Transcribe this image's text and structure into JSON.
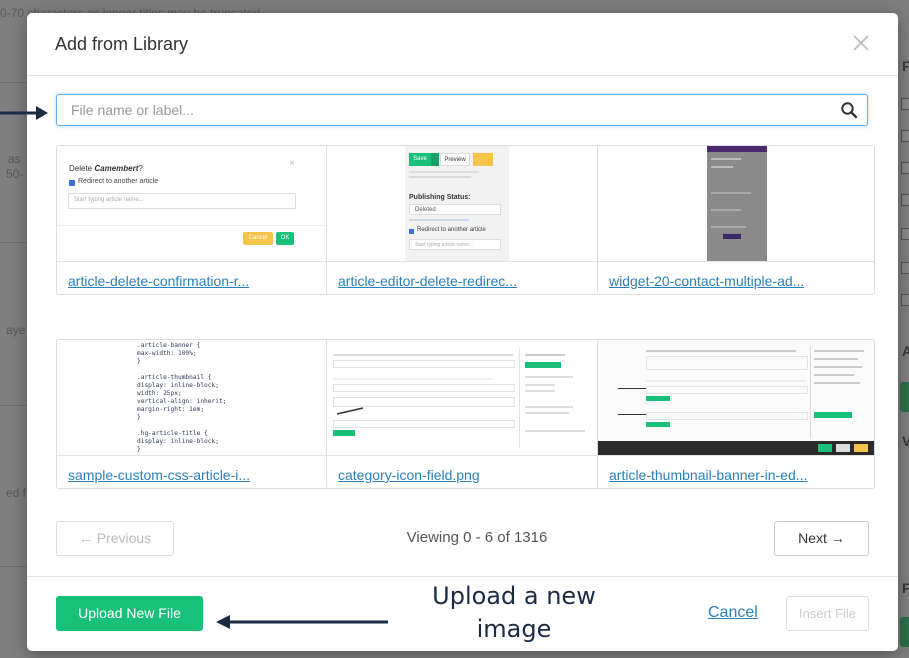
{
  "background": {
    "top_fragment": "0-70 characters as longer titles may be truncated",
    "left_fragments": [
      "as",
      "50-",
      "aye",
      "ed f"
    ],
    "right_fragments": [
      "F",
      "A",
      "V",
      "F"
    ]
  },
  "modal": {
    "title": "Add from Library",
    "search_placeholder": "File name or label...",
    "files": [
      {
        "name": "article-delete-confirmation-r..."
      },
      {
        "name": "article-editor-delete-redirec..."
      },
      {
        "name": "widget-20-contact-multiple-ad..."
      },
      {
        "name": "sample-custom-css-article-i..."
      },
      {
        "name": "category-icon-field.png"
      },
      {
        "name": "article-thumbnail-banner-in-ed..."
      }
    ],
    "thumb_delete_dialog": {
      "title_prefix": "Delete ",
      "title_em": "Camembert",
      "title_suffix": "?",
      "checkbox_label": "Redirect to another article",
      "input_placeholder": "Start typing article name...",
      "cancel": "Cancel",
      "ok": "OK"
    },
    "thumb_editor": {
      "save": "Save",
      "preview": "Preview",
      "status_heading": "Publishing Status:",
      "status_value": "Deleted",
      "checkbox_label": "Redirect to another article",
      "input_placeholder": "Start typing article name..."
    },
    "thumb_css_lines": [
      ".article-banner {",
      "  max-width: 100%;",
      "}",
      "",
      ".article-thumbnail {",
      "  display: inline-block;",
      "  width: 25px;",
      "  vertical-align: inherit;",
      "  margin-right: 1em;",
      "}",
      "",
      ".hg-article-title {",
      "  display: inline-block;",
      "}"
    ],
    "pagination": {
      "previous": "← Previous",
      "viewing": "Viewing 0 - 6 of 1316",
      "next": "Next →"
    },
    "footer": {
      "upload": "Upload New File",
      "cancel": "Cancel",
      "insert": "Insert File"
    }
  },
  "annotation": {
    "text_line1": "Upload a new",
    "text_line2": "image"
  },
  "colors": {
    "accent_green": "#18c07a",
    "link_blue": "#2a80b9",
    "focus_blue": "#66afe9",
    "annotation_navy": "#1c2b44"
  }
}
